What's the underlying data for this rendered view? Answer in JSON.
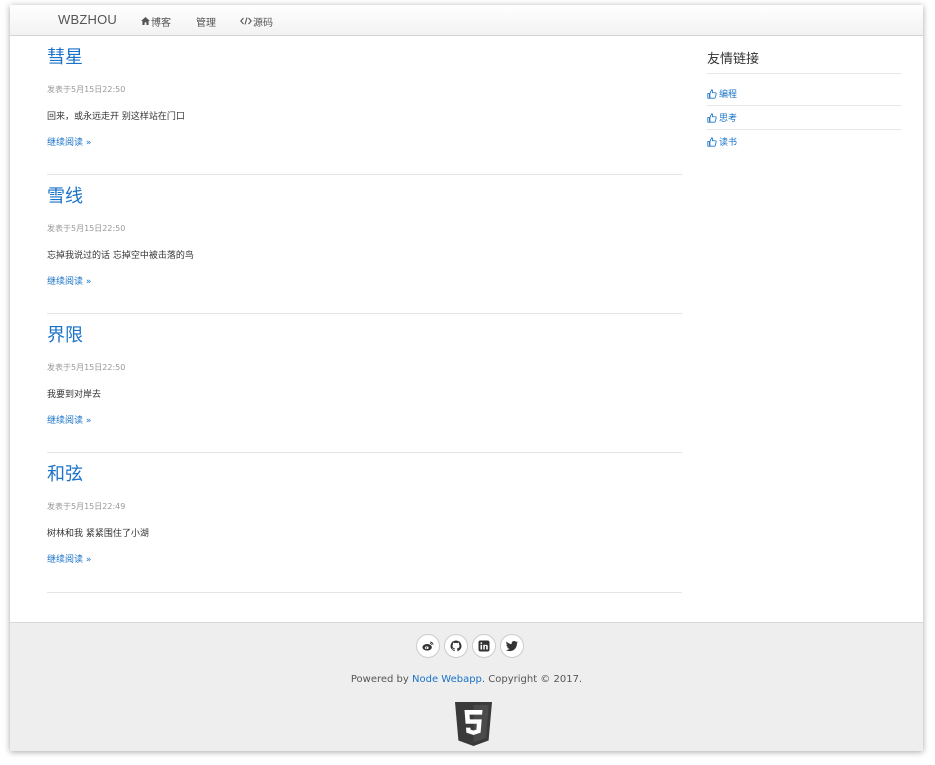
{
  "navbar": {
    "brand": "WBZHOU",
    "items": [
      {
        "icon": "home-icon",
        "label": "博客"
      },
      {
        "label": "管理"
      },
      {
        "icon": "code-icon",
        "label": "源码"
      }
    ]
  },
  "posts": [
    {
      "title": "彗星",
      "meta": "发表于5月15日22:50",
      "excerpt": "回来，或永远走开 别这样站在门口",
      "read_more": "继续阅读 »"
    },
    {
      "title": "雪线",
      "meta": "发表于5月15日22:50",
      "excerpt": "忘掉我说过的话 忘掉空中被击落的鸟",
      "read_more": "继续阅读 »"
    },
    {
      "title": "界限",
      "meta": "发表于5月15日22:50",
      "excerpt": "我要到对岸去",
      "read_more": "继续阅读 »"
    },
    {
      "title": "和弦",
      "meta": "发表于5月15日22:49",
      "excerpt": "树林和我 紧紧围住了小湖",
      "read_more": "继续阅读 »"
    }
  ],
  "sidebar": {
    "title": "友情链接",
    "links": [
      {
        "icon": "thumbs-up-icon",
        "label": "编程"
      },
      {
        "icon": "thumbs-up-icon",
        "label": "思考"
      },
      {
        "icon": "thumbs-up-icon",
        "label": "读书"
      }
    ]
  },
  "footer": {
    "socials": [
      "weibo-icon",
      "github-icon",
      "linkedin-icon",
      "twitter-icon"
    ],
    "powered_prefix": "Powered by ",
    "powered_link": "Node Webapp",
    "powered_suffix": ". Copyright © 2017.",
    "logo": "html5-logo"
  },
  "colors": {
    "link": "#1a73c8",
    "text": "#333333",
    "meta": "#999999",
    "footer_bg": "#eeeeee"
  }
}
